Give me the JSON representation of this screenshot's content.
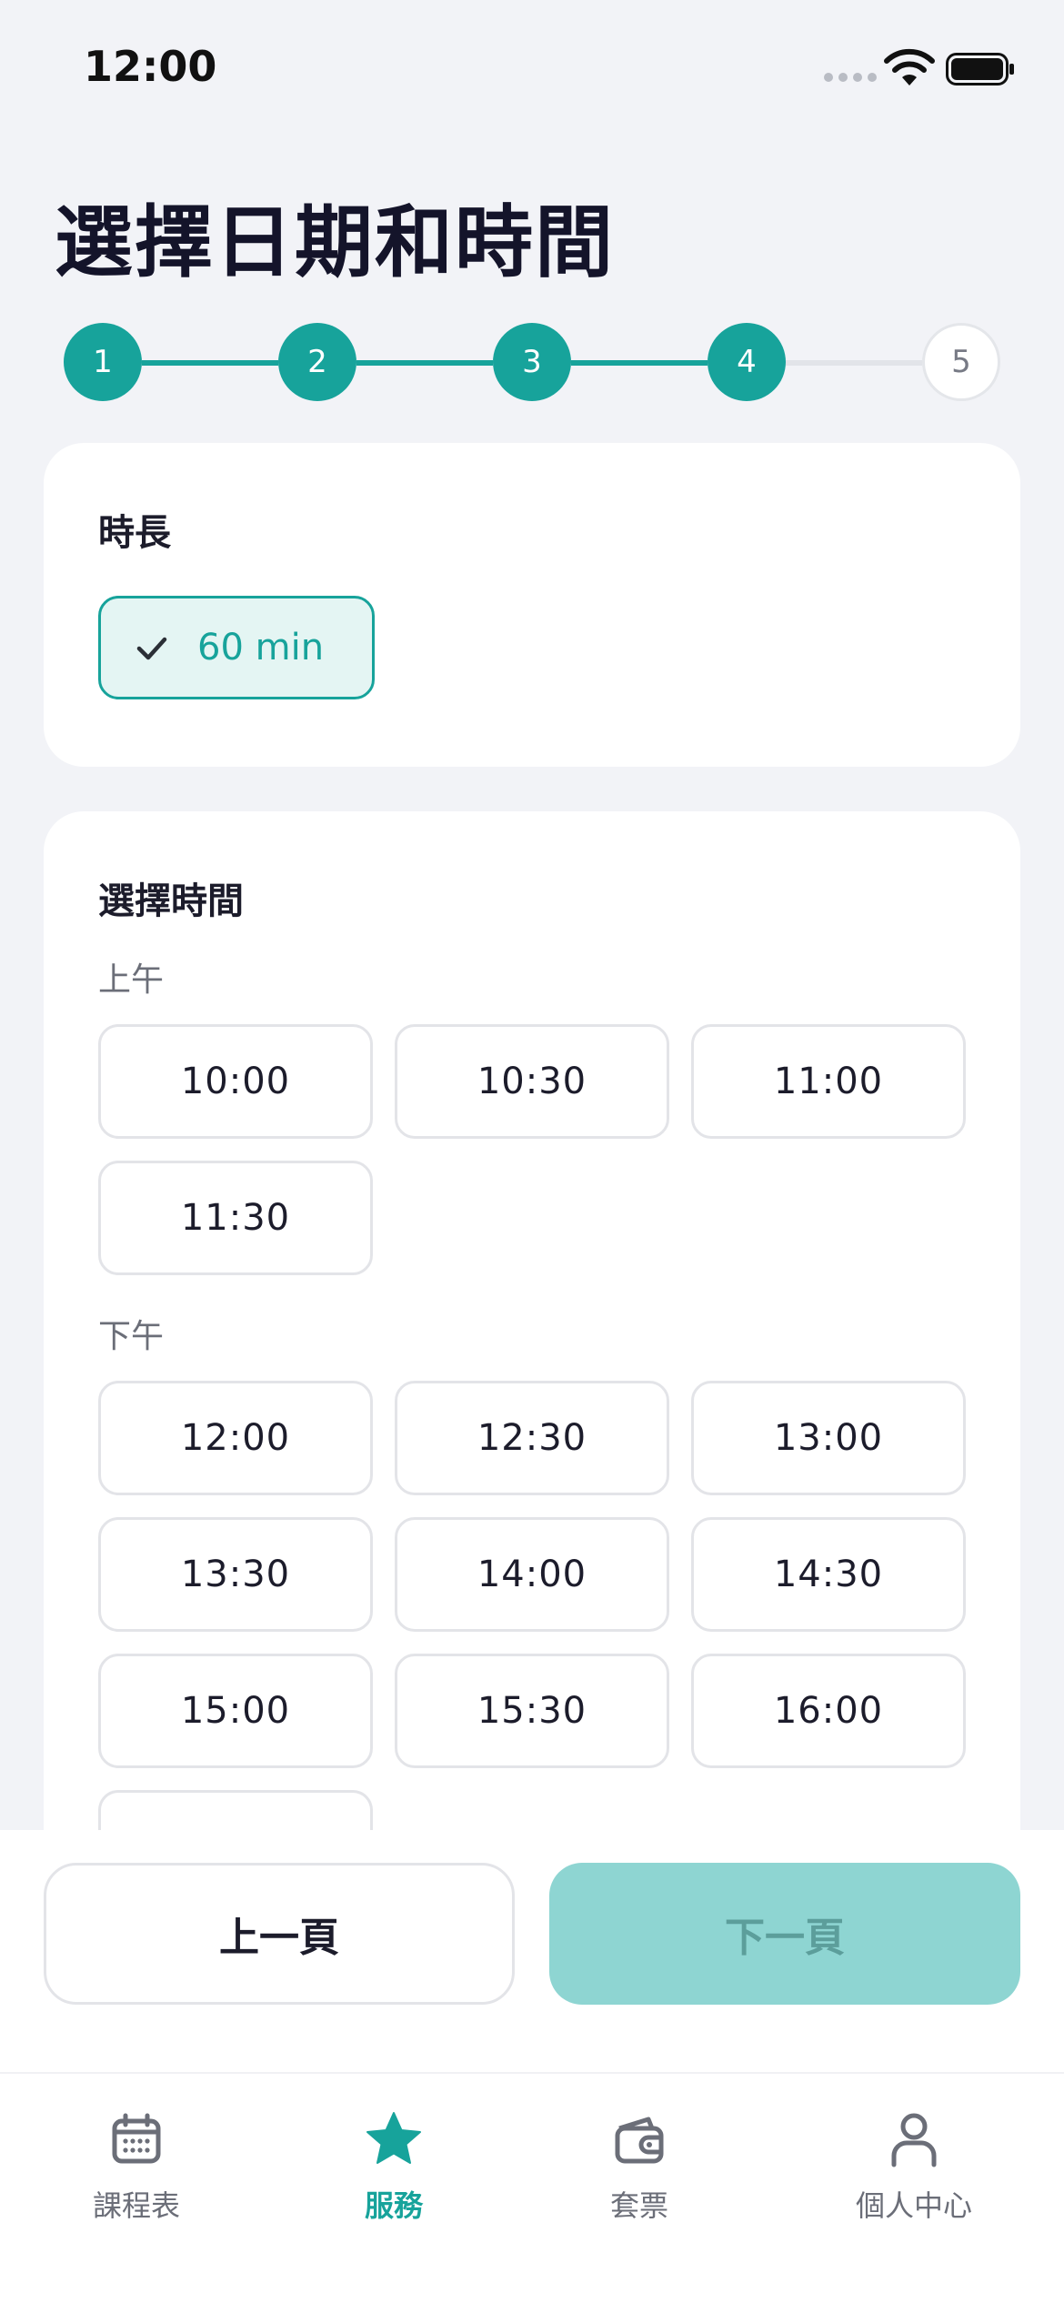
{
  "status_bar": {
    "time": "12:00"
  },
  "page": {
    "title": "選擇日期和時間"
  },
  "stepper": {
    "steps": [
      {
        "label": "1",
        "state": "completed"
      },
      {
        "label": "2",
        "state": "completed"
      },
      {
        "label": "3",
        "state": "completed"
      },
      {
        "label": "4",
        "state": "current"
      },
      {
        "label": "5",
        "state": "upcoming"
      }
    ]
  },
  "duration": {
    "label": "時長",
    "selected": "60 min"
  },
  "time_select": {
    "label": "選擇時間",
    "morning": {
      "label": "上午",
      "slots": [
        "10:00",
        "10:30",
        "11:00",
        "11:30"
      ]
    },
    "afternoon": {
      "label": "下午",
      "slots": [
        "12:00",
        "12:30",
        "13:00",
        "13:30",
        "14:00",
        "14:30",
        "15:00",
        "15:30",
        "16:00"
      ]
    }
  },
  "actions": {
    "prev_label": "上一頁",
    "next_label": "下一頁"
  },
  "tab_bar": {
    "tabs": [
      {
        "label": "課程表",
        "icon": "calendar-icon"
      },
      {
        "label": "服務",
        "icon": "star-icon",
        "active": true
      },
      {
        "label": "套票",
        "icon": "wallet-icon"
      },
      {
        "label": "個人中心",
        "icon": "person-icon"
      }
    ]
  },
  "colors": {
    "accent": "#17a39b",
    "accent_light": "#e4f5f3",
    "next_disabled": "#8ed5d2",
    "background": "#f2f3f7"
  }
}
